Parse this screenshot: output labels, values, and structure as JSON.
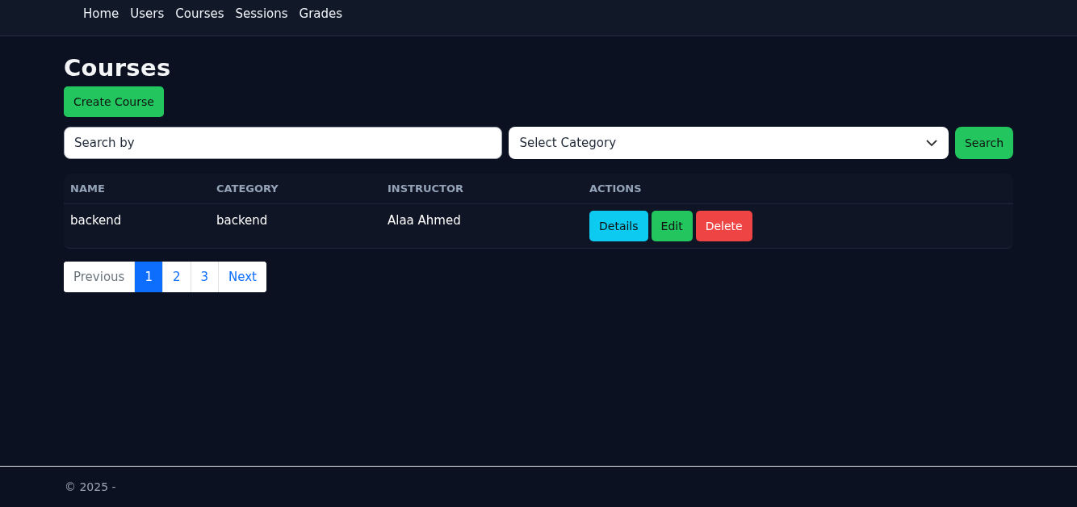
{
  "nav": [
    {
      "label": "Home"
    },
    {
      "label": "Users"
    },
    {
      "label": "Courses"
    },
    {
      "label": "Sessions"
    },
    {
      "label": "Grades"
    }
  ],
  "title": "Courses",
  "create_button": "Create Course",
  "search": {
    "placeholder": "Search by"
  },
  "category_select": {
    "value": "Select Category"
  },
  "search_button": "Search",
  "table": {
    "columns": [
      "NAME",
      "CATEGORY",
      "INSTRUCTOR",
      "ACTIONS"
    ],
    "rows": [
      {
        "cells": [
          "backend",
          "backend",
          "Alaa Ahmed"
        ],
        "actions": [
          {
            "label": "Details",
            "kind": "info"
          },
          {
            "label": "Edit",
            "kind": "success"
          },
          {
            "label": "Delete",
            "kind": "danger"
          }
        ]
      }
    ]
  },
  "pagination": [
    {
      "label": "Previous",
      "selected": false,
      "disabled": true
    },
    {
      "label": "1",
      "selected": true,
      "disabled": false
    },
    {
      "label": "2",
      "selected": false,
      "disabled": false
    },
    {
      "label": "3",
      "selected": false,
      "disabled": false
    },
    {
      "label": "Next",
      "selected": false,
      "disabled": false
    }
  ],
  "footer": "© 2025 -"
}
